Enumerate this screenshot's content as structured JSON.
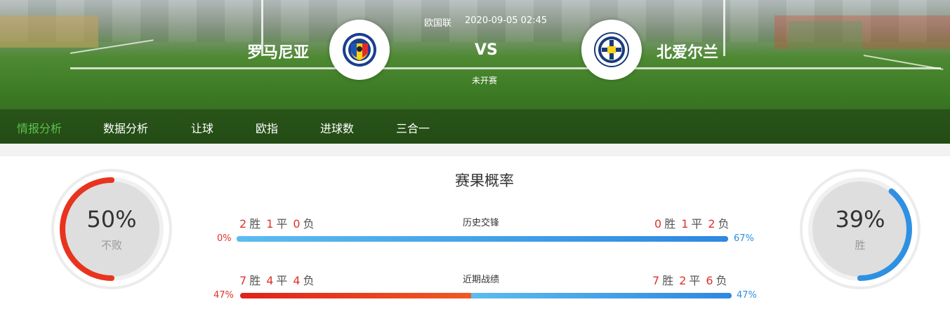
{
  "header": {
    "league": "欧国联",
    "datetime": "2020-09-05 02:45",
    "vs": "VS",
    "status": "未开赛",
    "home_team": "罗马尼亚",
    "away_team": "北爱尔兰",
    "home_badge_icon": "romania-fa-crest-icon",
    "away_badge_icon": "northern-ireland-fa-crest-icon"
  },
  "nav": {
    "tabs": [
      {
        "label": "情报分析",
        "active": true
      },
      {
        "label": "数据分析",
        "active": false
      },
      {
        "label": "让球",
        "active": false
      },
      {
        "label": "欧指",
        "active": false
      },
      {
        "label": "进球数",
        "active": false
      },
      {
        "label": "三合一",
        "active": false
      }
    ]
  },
  "probability": {
    "title": "赛果概率",
    "left": {
      "percent": "50%",
      "label": "不败",
      "value": 0.5,
      "color": "#e8341e"
    },
    "right": {
      "percent": "39%",
      "label": "胜",
      "value": 0.39,
      "color": "#2e90e2"
    }
  },
  "history": {
    "label": "历史交锋",
    "home": {
      "w": "2",
      "w_label": "胜",
      "d": "1",
      "d_label": "平",
      "l": "0",
      "l_label": "负"
    },
    "away": {
      "w": "0",
      "w_label": "胜",
      "d": "1",
      "d_label": "平",
      "l": "2",
      "l_label": "负"
    },
    "home_pct": "0%",
    "away_pct": "67%",
    "home_fraction": 0.0
  },
  "recent": {
    "label": "近期战绩",
    "home": {
      "w": "7",
      "w_label": "胜",
      "d": "4",
      "d_label": "平",
      "l": "4",
      "l_label": "负"
    },
    "away": {
      "w": "7",
      "w_label": "胜",
      "d": "2",
      "d_label": "平",
      "l": "6",
      "l_label": "负"
    },
    "home_pct": "47%",
    "away_pct": "47%",
    "home_fraction": 0.47
  }
}
